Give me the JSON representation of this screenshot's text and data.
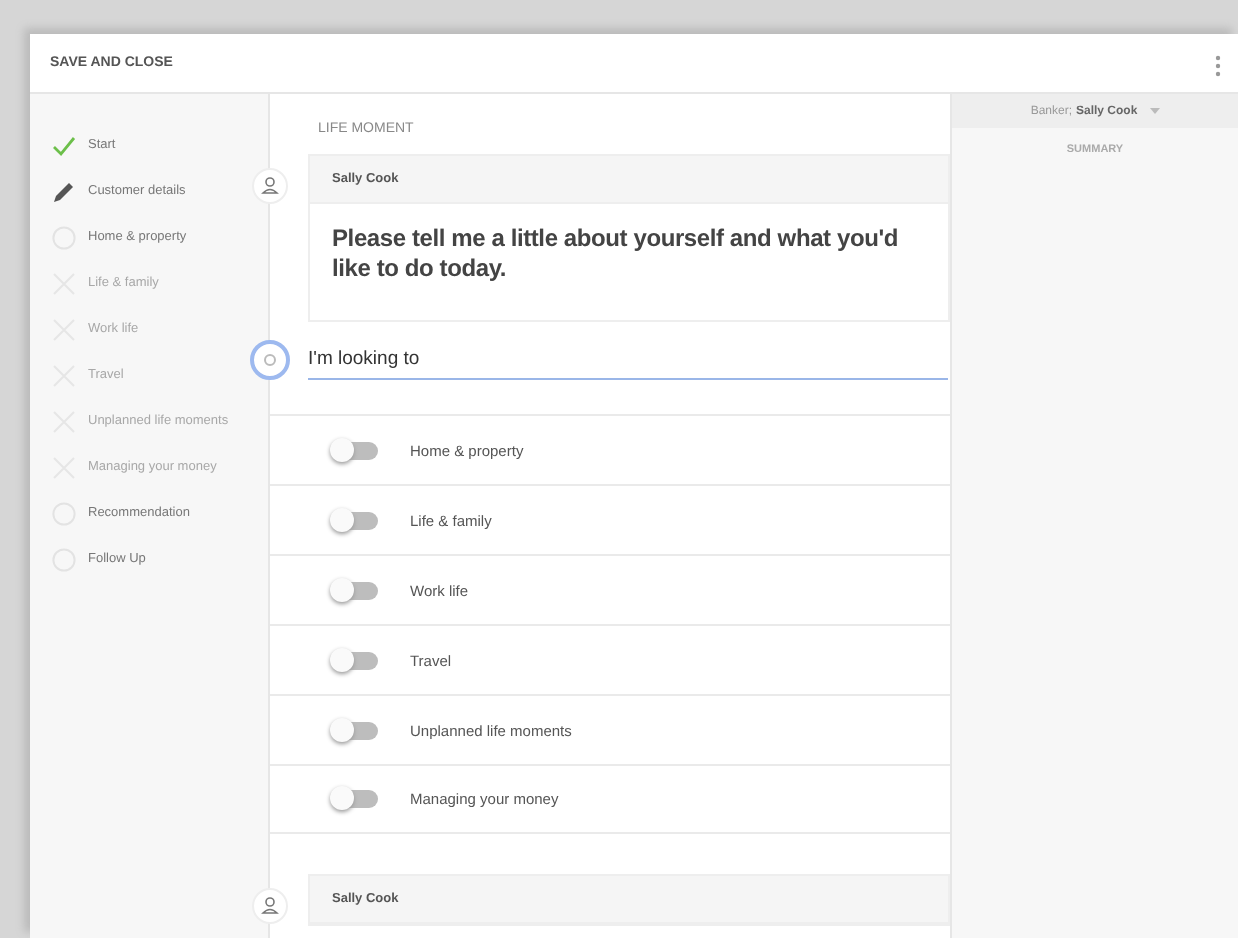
{
  "header": {
    "action": "SAVE AND CLOSE"
  },
  "steps": [
    {
      "label": "Start",
      "kind": "done"
    },
    {
      "label": "Customer details",
      "kind": "edit"
    },
    {
      "label": "Home & property",
      "kind": "pending"
    },
    {
      "label": "Life & family",
      "kind": "skipped"
    },
    {
      "label": "Work life",
      "kind": "skipped"
    },
    {
      "label": "Travel",
      "kind": "skipped"
    },
    {
      "label": "Unplanned life moments",
      "kind": "skipped"
    },
    {
      "label": "Managing your money",
      "kind": "skipped"
    },
    {
      "label": "Recommendation",
      "kind": "pending"
    },
    {
      "label": "Follow Up",
      "kind": "pending"
    }
  ],
  "section_title": "LIFE MOMENT",
  "message": {
    "sender": "Sally Cook",
    "text": "Please tell me a little about yourself and what you'd like to do today."
  },
  "answer": {
    "value": "I'm looking to "
  },
  "options": [
    {
      "label": "Home & property",
      "on": false
    },
    {
      "label": "Life & family",
      "on": false
    },
    {
      "label": "Work life",
      "on": false
    },
    {
      "label": "Travel",
      "on": false
    },
    {
      "label": "Unplanned life moments",
      "on": false
    },
    {
      "label": "Managing your money",
      "on": false
    }
  ],
  "next_message": {
    "sender": "Sally Cook"
  },
  "banker": {
    "prefix": "Banker;",
    "name": "Sally Cook"
  },
  "summary_title": "SUMMARY"
}
